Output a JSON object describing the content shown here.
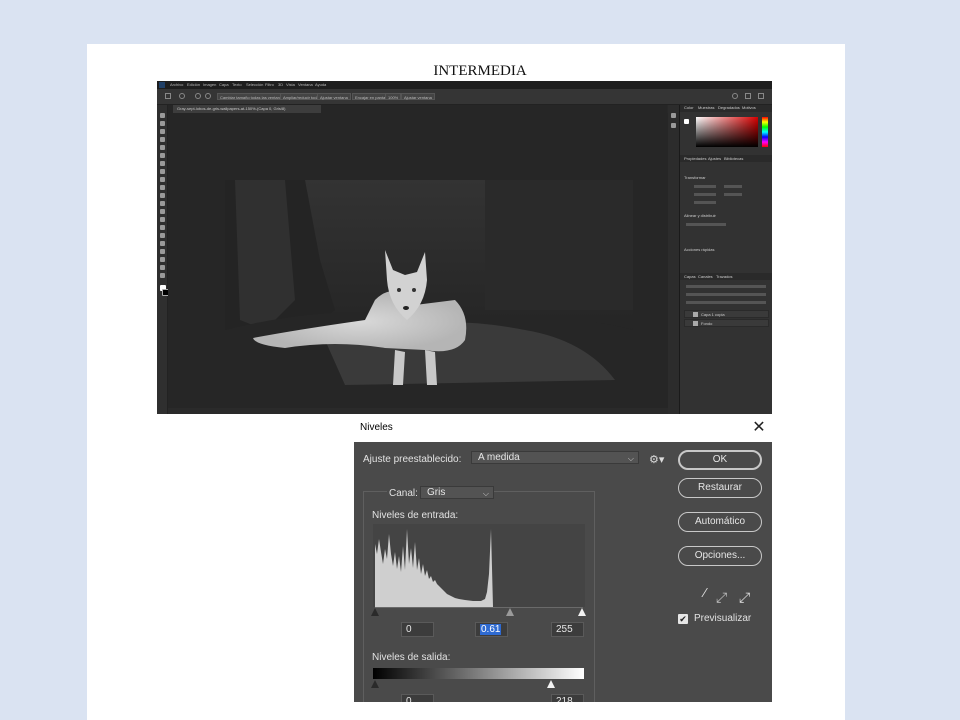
{
  "slide": {
    "title": "INTERMEDIA"
  },
  "photoshop": {
    "menu": [
      "Archivo",
      "Edición",
      "Imagen",
      "Capa",
      "Texto",
      "Selección",
      "Filtro",
      "3D",
      "Vista",
      "Ventana",
      "Ayuda"
    ],
    "options": [
      "Cambiar tamaño todas las ventanas",
      "Ampliar/reducir todas las ventanas",
      "Ajustar ventana",
      "Encajar en pantalla",
      "100%",
      "Ajustar ventana"
    ],
    "document_tab": "Gray-sept-lobos-de-gris-wallpapers-at-150%-(Capa 0, Gris/8)",
    "panels": {
      "top_tabs": [
        "Color",
        "Muestras",
        "Degradados",
        "Motivos"
      ],
      "mid_tabs": [
        "Propiedades",
        "Ajustes",
        "Bibliotecas"
      ],
      "layer_tabs": [
        "Capas",
        "Canales",
        "Trazados"
      ],
      "sections": [
        "Transformar",
        "Alinear y distribuir",
        "Acciones rápidas"
      ],
      "layers": [
        "Capa 1 copia",
        "Fondo"
      ]
    }
  },
  "dialog": {
    "title": "Niveles",
    "preset_label": "Ajuste preestablecido:",
    "preset_value": "A medida",
    "channel_label": "Canal:",
    "channel_value": "Gris",
    "input_label": "Niveles de entrada:",
    "input_black": "0",
    "input_gamma": "0.61",
    "input_white": "255",
    "output_label": "Niveles de salida:",
    "output_black": "0",
    "output_white": "218",
    "buttons": {
      "ok": "OK",
      "reset": "Restaurar",
      "auto": "Automático",
      "options": "Opciones..."
    },
    "preview_label": "Previsualizar",
    "preview_checked": true,
    "icons": [
      "gear-icon",
      "black-eyedropper-icon",
      "gray-eyedropper-icon",
      "white-eyedropper-icon",
      "close-icon",
      "check-icon"
    ]
  }
}
